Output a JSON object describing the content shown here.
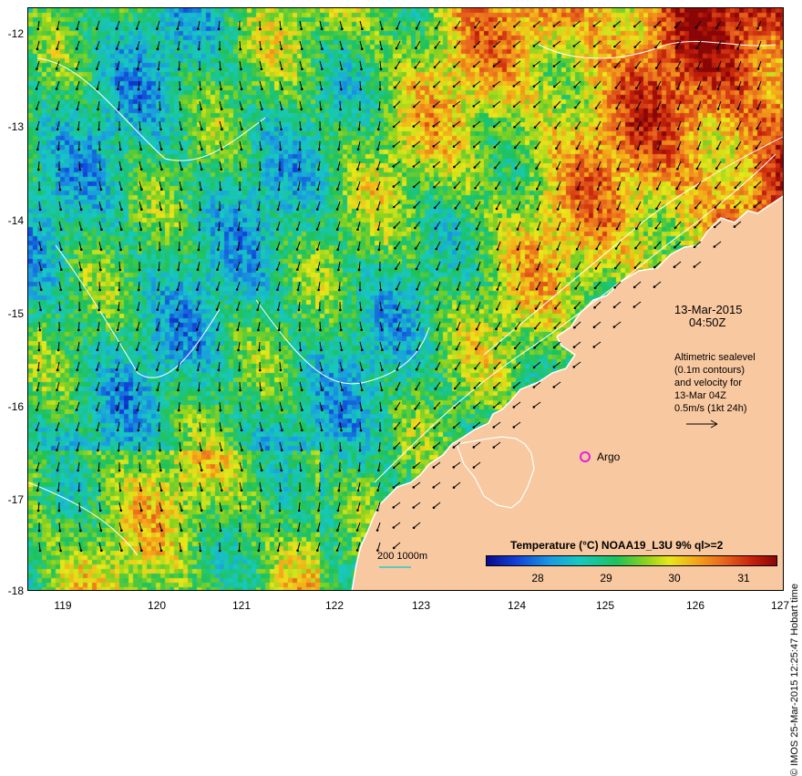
{
  "map": {
    "y_axis_labels": [
      "-12",
      "-13",
      "-14",
      "-15",
      "-16",
      "-17",
      "-18"
    ],
    "x_axis_labels": [
      "119",
      "120",
      "121",
      "122",
      "123",
      "124",
      "125",
      "126",
      "127"
    ],
    "date_line1": "13-Mar-2015",
    "date_line2": "04:50Z",
    "altimetry_lines": [
      "Altimetric sealevel",
      "(0.1m contours)",
      "and velocity for",
      "13-Mar 04Z",
      "0.5m/s (1kt 24h)"
    ],
    "argo_label": "Argo",
    "colorbar_title": "Temperature (°C) NOAA19_L3U 9% ql>=2",
    "colorbar_ticks": [
      "28",
      "29",
      "30",
      "31"
    ],
    "bathymetry_label": "200  1000m",
    "credit": "© IMOS 25-Mar-2015 12:25:47 Hobart time",
    "colors": {
      "land": "#f8c8a0",
      "contour": "#ffffff",
      "argo": "#e020e0",
      "bathy_line": "#30c8c8"
    }
  }
}
